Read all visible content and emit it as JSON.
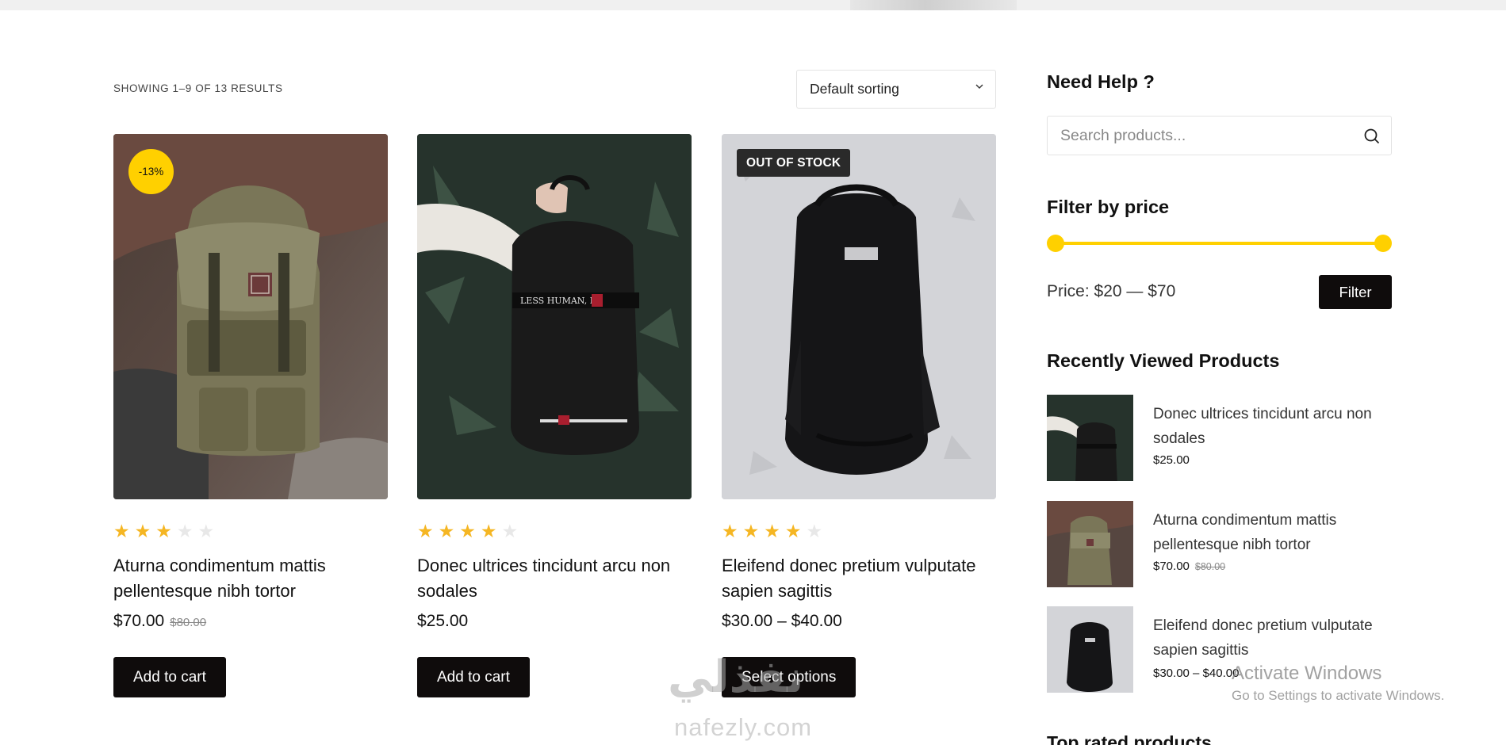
{
  "results": {
    "label": "SHOWING 1–9 OF 13 RESULTS"
  },
  "sorting": {
    "selected": "Default sorting"
  },
  "products": [
    {
      "title": "Aturna condimentum mattis pellentesque nibh tortor",
      "price": "$70.00",
      "old_price": "$80.00",
      "badge": "-13%",
      "rating": 3,
      "button": "Add to cart"
    },
    {
      "title": "Donec ultrices tincidunt arcu non sodales",
      "price": "$25.00",
      "rating": 4,
      "button": "Add to cart"
    },
    {
      "title": "Eleifend donec pretium vulputate sapien sagittis",
      "price": "$30.00 – $40.00",
      "badge": "OUT OF STOCK",
      "rating": 4,
      "button": "Select options"
    }
  ],
  "sidebar": {
    "help": {
      "heading": "Need Help ?",
      "search_placeholder": "Search products..."
    },
    "price_filter": {
      "heading": "Filter by price",
      "label": "Price: $20 — $70",
      "min": 20,
      "max": 70,
      "low_fraction": 0.0,
      "high_fraction": 1.0,
      "button": "Filter"
    },
    "recently_viewed": {
      "heading": "Recently Viewed Products",
      "items": [
        {
          "title": "Donec ultrices tincidunt arcu non sodales",
          "price": "$25.00"
        },
        {
          "title": "Aturna condimentum mattis pellentesque nibh tortor",
          "price": "$70.00",
          "old_price": "$80.00"
        },
        {
          "title": "Eleifend donec pretium vulputate sapien sagittis",
          "price": "$30.00 – $40.00"
        }
      ]
    },
    "top_rated": {
      "heading": "Top rated products"
    }
  },
  "overlays": {
    "watermark_arabic": "نفذلي",
    "watermark_domain": "nafezly.com",
    "activate_title": "Activate Windows",
    "activate_sub": "Go to Settings to activate Windows."
  },
  "colors": {
    "accent": "#ffd000",
    "star": "#f5b623",
    "button": "#0f0c0c"
  },
  "icons": [
    "chevron-down-icon",
    "search-icon",
    "star-icon"
  ]
}
